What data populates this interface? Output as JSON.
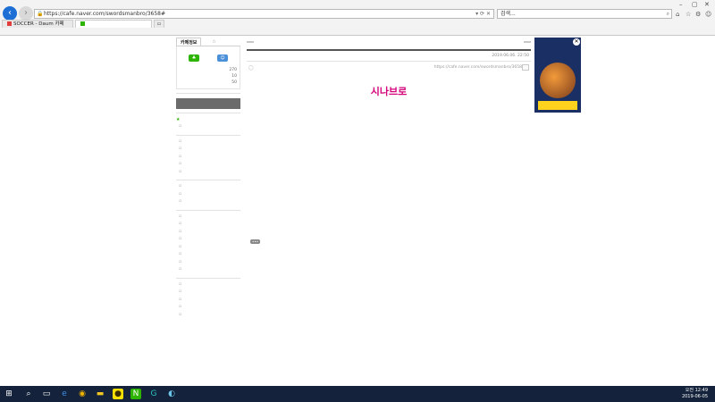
{
  "browser": {
    "url": "https://cafe.naver.com/swordsmanbro/3658#",
    "search_placeholder": "검색...",
    "tabs": [
      {
        "label": "SOCCER - Daum 카페"
      },
      {
        "label": "",
        "active": true
      }
    ],
    "menu": [
      "",
      "",
      "",
      "",
      "",
      ""
    ]
  },
  "sidebar": {
    "tab_info": "카페정보",
    "tab_activity": "",
    "user": "",
    "since": "",
    "edit_label": "",
    "stat1_value": "",
    "stat2_value": "",
    "stat2_label": "",
    "counts": [
      {
        "label": "",
        "value": "270"
      },
      {
        "label": "",
        "value": "10"
      },
      {
        "label": "",
        "value": "50"
      }
    ],
    "btn_invite": "",
    "btn_join": "",
    "write_label": "",
    "favorites_head": "",
    "favorites_items": [
      ""
    ],
    "sections": [
      {
        "head": "",
        "items": [
          "",
          "",
          "",
          "",
          ""
        ]
      },
      {
        "head": "",
        "items": [
          "",
          "",
          ""
        ]
      },
      {
        "head": "",
        "items": [
          "",
          "",
          "",
          "",
          "",
          "",
          "",
          ""
        ]
      },
      {
        "head": "",
        "items": [
          "",
          "",
          "",
          "",
          ""
        ]
      }
    ]
  },
  "post": {
    "back_label": "",
    "list_label": "",
    "title": "",
    "meta": "2019.06.06. 22:50",
    "actions": [
      "",
      "",
      ""
    ],
    "author": "",
    "permalink": "https://cafe.naver.com/swordsmanbro/3658",
    "copy_label": "",
    "heading_brand": "시나브로",
    "heading_rest": "",
    "guide": "",
    "body_lines": [],
    "notice_lines": [],
    "warning": "",
    "more_label": ""
  },
  "ad": {
    "line1": "",
    "line2": "",
    "cta": ""
  },
  "taskbar": {
    "time": "오전 12:49",
    "date": "2019-06-05",
    "tray": ""
  }
}
